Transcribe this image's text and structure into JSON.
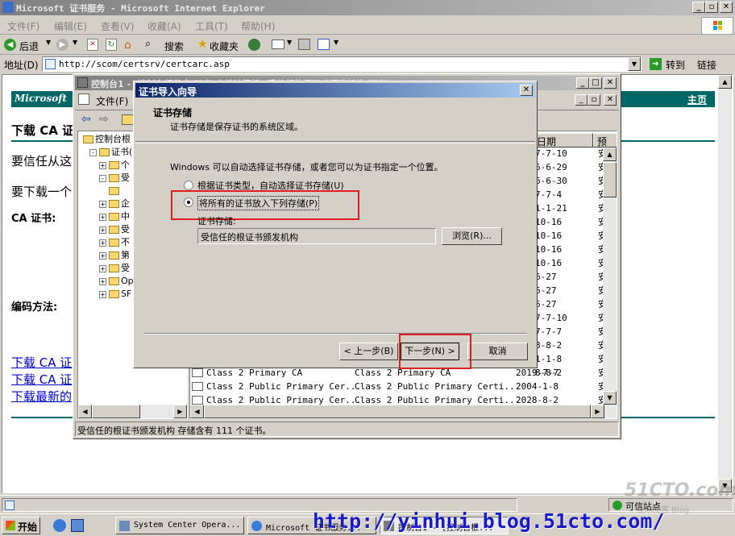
{
  "ie": {
    "title": "Microsoft 证书服务 - Microsoft Internet Explorer",
    "menu": [
      "文件(F)",
      "编辑(E)",
      "查看(V)",
      "收藏(A)",
      "工具(T)",
      "帮助(H)"
    ],
    "toolbar": {
      "back": "后退",
      "search": "搜索",
      "favorites": "收藏夹"
    },
    "address_label": "地址(D)",
    "address_value": "http://scom/certsrv/certcarc.asp",
    "go_label": "转到",
    "links_label": "链接",
    "status_zone": "可信站点"
  },
  "page": {
    "header_left": "Microsoft",
    "header_right": "主页",
    "heading": "下载 CA 证",
    "line1": "要信任从这",
    "line2": "要下载一个",
    "ca_cert_label": "CA 证书:",
    "encoding_label": "编码方法:",
    "links": [
      "下载 CA 证",
      "下载 CA 证",
      "下载最新的"
    ]
  },
  "mmc": {
    "title": "控制台1 - [控制台根节点\\证书(本地计算机)\\受信任的根证书颁发机构\\证书]",
    "menu_file": "文件(F)",
    "tree": [
      {
        "label": "控制台根",
        "indent": 0,
        "exp": ""
      },
      {
        "label": "证书(",
        "indent": 1,
        "exp": "-"
      },
      {
        "label": "个",
        "indent": 2,
        "exp": "+"
      },
      {
        "label": "受",
        "indent": 2,
        "exp": "-"
      },
      {
        "label": "",
        "indent": 3,
        "exp": ""
      },
      {
        "label": "企",
        "indent": 2,
        "exp": "+"
      },
      {
        "label": "中",
        "indent": 2,
        "exp": "+"
      },
      {
        "label": "受",
        "indent": 2,
        "exp": "+"
      },
      {
        "label": "不",
        "indent": 2,
        "exp": "+"
      },
      {
        "label": "第",
        "indent": 2,
        "exp": "+"
      },
      {
        "label": "受",
        "indent": 2,
        "exp": "+"
      },
      {
        "label": "Op",
        "indent": 2,
        "exp": "+"
      },
      {
        "label": "SF",
        "indent": 2,
        "exp": "+"
      }
    ],
    "col_date": "日期",
    "col_purpose": "预",
    "dates": [
      "7-7-10",
      "6-6-29",
      "6-6-30",
      "7-7-4",
      "1-1-21",
      "10-16",
      "10-16",
      "10-16",
      "10-16",
      "6-27",
      "6-27",
      "6-27",
      "7-7-10",
      "7-7-7",
      "8-8-2",
      "1-1-8",
      "8-8-2"
    ],
    "purpose_char": "安",
    "bottom_rows": [
      {
        "issued_to": "Class 2 Primary CA",
        "issued_by": "Class 2 Primary CA",
        "date": "2019-7-7"
      },
      {
        "issued_to": "Class 2 Public Primary Cer...",
        "issued_by": "Class 2 Public Primary Certi...",
        "date": "2004-1-8"
      },
      {
        "issued_to": "Class 2 Public Primary Cer...",
        "issued_by": "Class 2 Public Primary Certi...",
        "date": "2028-8-2"
      }
    ],
    "status": "受信任的根证书颁发机构 存储含有 111 个证书。"
  },
  "wizard": {
    "title": "证书导入向导",
    "section_title": "证书存储",
    "section_desc": "证书存储是保存证书的系统区域。",
    "intro": "Windows 可以自动选择证书存储，或者您可以为证书指定一个位置。",
    "option_auto": "根据证书类型，自动选择证书存储(U)",
    "option_manual": "将所有的证书放入下列存储(P)",
    "selected_option": "manual",
    "store_label": "证书存储:",
    "store_value": "受信任的根证书颁发机构",
    "browse_label": "浏览(R)...",
    "back_label": "< 上一步(B)",
    "next_label": "下一步(N) >",
    "cancel_label": "取消"
  },
  "taskbar": {
    "start": "开始",
    "items": [
      "System Center Opera...",
      "Microsoft 证书服务...",
      "控制台1 - [控制台根..."
    ]
  },
  "watermark": {
    "url": "http://yinhui.blog.51cto.com/",
    "brand": "51CTO.com",
    "tag": "技术博客 Blog"
  },
  "colors": {
    "title_active": "#0a246a",
    "highlight_box": "#e02020",
    "page_header": "#006666",
    "link": "#0000cc"
  }
}
